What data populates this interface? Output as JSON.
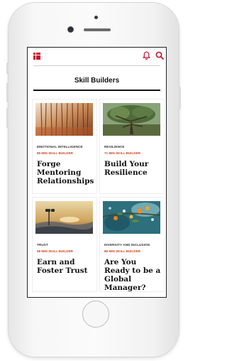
{
  "header": {
    "menu_icon": "grid-menu-icon",
    "notification_icon": "bell-icon",
    "search_icon": "search-icon",
    "accent_color": "#c8102e"
  },
  "page": {
    "title": "Skill Builders"
  },
  "cards": [
    {
      "category": "EMOTIONAL INTELLIGENCE",
      "duration": "85 MIN SKILL BUILDER",
      "title": "Forge Mentoring Relationships",
      "image": "forest-image"
    },
    {
      "category": "RESILIENCE",
      "duration": "71 MIN SKILL BUILDER",
      "title": "Build Your Resilience",
      "image": "oak-tree-image"
    },
    {
      "category": "TRUST",
      "duration": "58 MIN SKILL BUILDER",
      "title": "Earn and Foster Trust",
      "image": "binoculars-sunrise-image"
    },
    {
      "category": "DIVERSITY AND INCLUSION",
      "duration": "89 MIN SKILL BUILDER",
      "title": "Are You Ready to be a Global Manager?",
      "image": "citrus-branch-image"
    }
  ]
}
